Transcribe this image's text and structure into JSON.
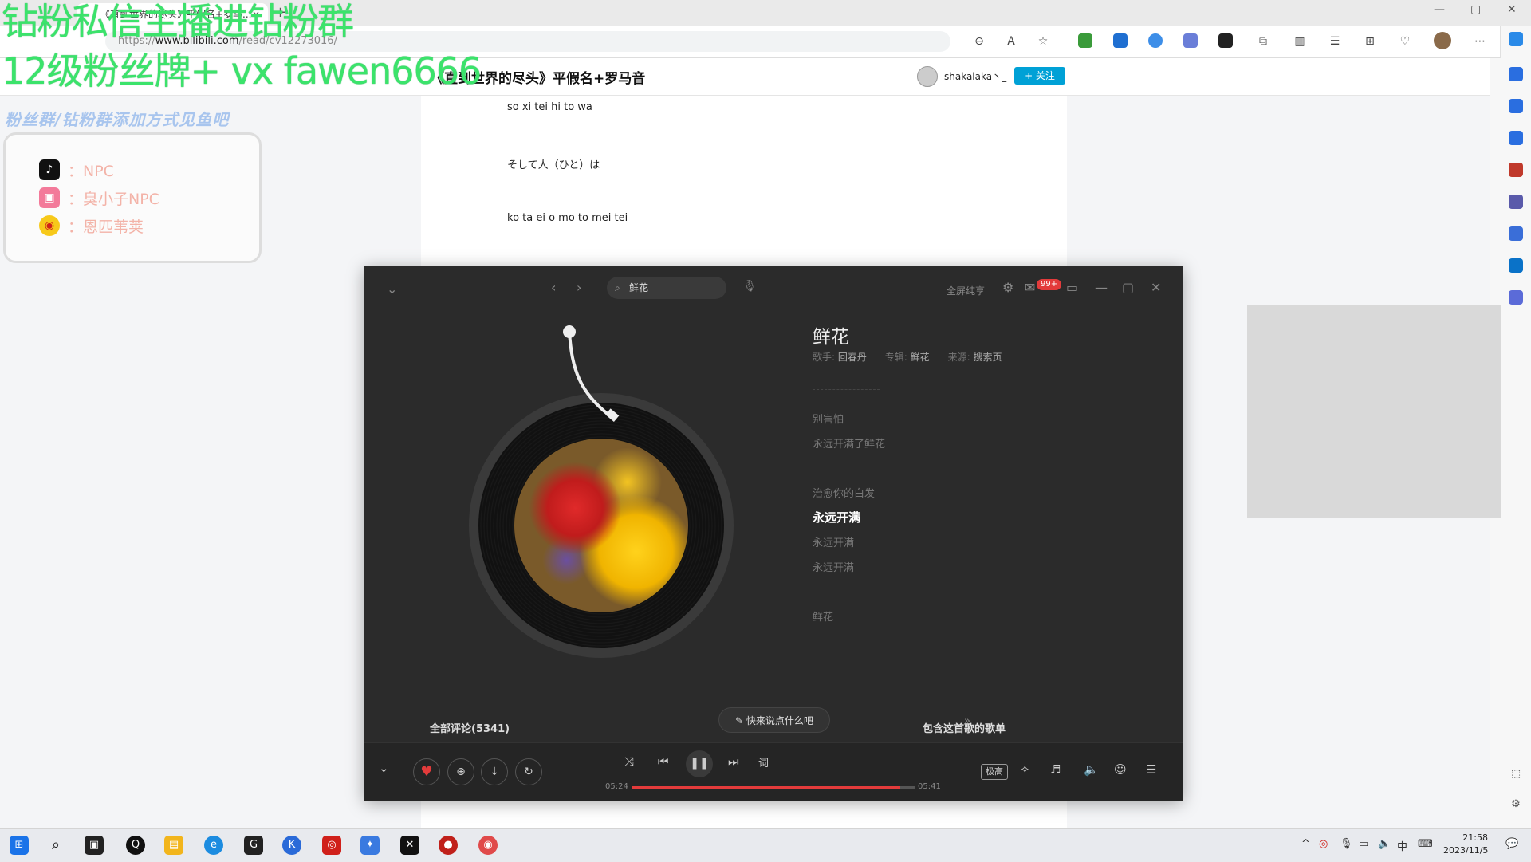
{
  "browser": {
    "tab_title": "《直到世界的尽头》平假名+罗马...",
    "tab_close": "×",
    "new_tab": "+",
    "url_scheme": "https://",
    "url_host": "www.bilibili.com",
    "url_path": "/read/cv12273016/",
    "minimize": "—",
    "maximize": "▢",
    "close": "✕"
  },
  "article": {
    "title": "《直到世界的尽头》平假名+罗马音",
    "author": "shakalaka丶_",
    "follow_label": "+ 关注",
    "lines": [
      "so xi tei hi to wa",
      "そして人（ひと）は",
      "ko ta ei o mo to mei tei"
    ]
  },
  "overlay": {
    "line1": "钻粉私信主播进钻粉群",
    "line2": "12级粉丝牌+ vx fawen6666",
    "line3": "粉丝群/钻粉群添加方式见鱼吧",
    "social": [
      {
        "platform": "douyin-icon",
        "text": "：NPC"
      },
      {
        "platform": "bilibili-icon",
        "text": "：臭小子NPC"
      },
      {
        "platform": "weibo-icon",
        "text": "：恩匹苇荚"
      }
    ]
  },
  "player": {
    "search_value": "鲜花",
    "fullscreen_label": "全屏纯享",
    "message_badge": "99+",
    "song_title": "鲜花",
    "singer_label": "歌手:",
    "singer": "回春丹",
    "album_label": "专辑:",
    "album": "鲜花",
    "source_label": "来源:",
    "source": "搜索页",
    "lyrics": [
      {
        "text": "别害怕",
        "current": false
      },
      {
        "text": "永远开满了鲜花",
        "current": false
      },
      {
        "text": "治愈你的白发",
        "current": false
      },
      {
        "text": "永远开满",
        "current": true
      },
      {
        "text": "永远开满",
        "current": false
      },
      {
        "text": "永远开满",
        "current": false
      },
      {
        "text": "鲜花",
        "current": false
      }
    ],
    "comments_label": "全部评论(5341)",
    "say_label": "快来说点什么吧",
    "playlists_label": "包含这首歌的歌单",
    "lyric_toggle": "词",
    "quality": "极高",
    "time_current": "05:24",
    "time_total": "05:41",
    "progress": 0.95
  },
  "taskbar": {
    "ime": "中",
    "time": "21:58",
    "date": "2023/11/5"
  },
  "colors": {
    "accent": "#e33b3b",
    "bilibili_blue": "#00a1d6",
    "overlay_green": "#3be36b"
  }
}
